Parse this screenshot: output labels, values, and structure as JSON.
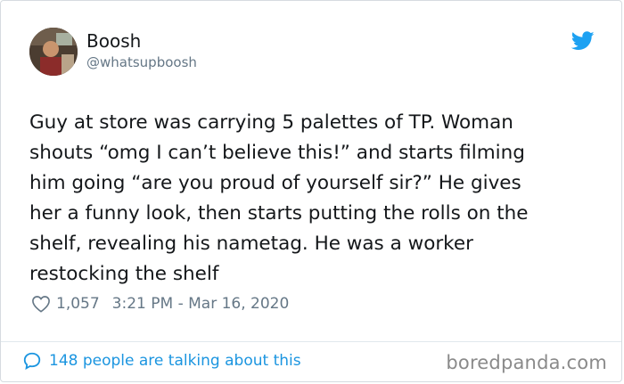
{
  "author": {
    "display_name": "Boosh",
    "handle": "@whatsupboosh",
    "avatar_icon": "profile-photo"
  },
  "brand": {
    "icon": "twitter-bird-icon",
    "color": "#1da1f2"
  },
  "tweet": {
    "text": "Guy at store was carrying 5 palettes of TP. Woman\nshouts “omg I can’t believe this!” and starts filming\nhim going “are you proud of yourself sir?” He gives\nher a funny look, then starts putting the rolls on the\nshelf, revealing his nametag. He was a worker\nrestocking the shelf"
  },
  "meta": {
    "likes": "1,057",
    "timestamp": "3:21 PM - Mar 16, 2020",
    "like_icon": "heart-icon"
  },
  "footer": {
    "talking_label": "148 people are talking about this",
    "talking_icon": "speech-bubble-icon",
    "link_color": "#1b95e0",
    "watermark": "boredpanda.com"
  }
}
